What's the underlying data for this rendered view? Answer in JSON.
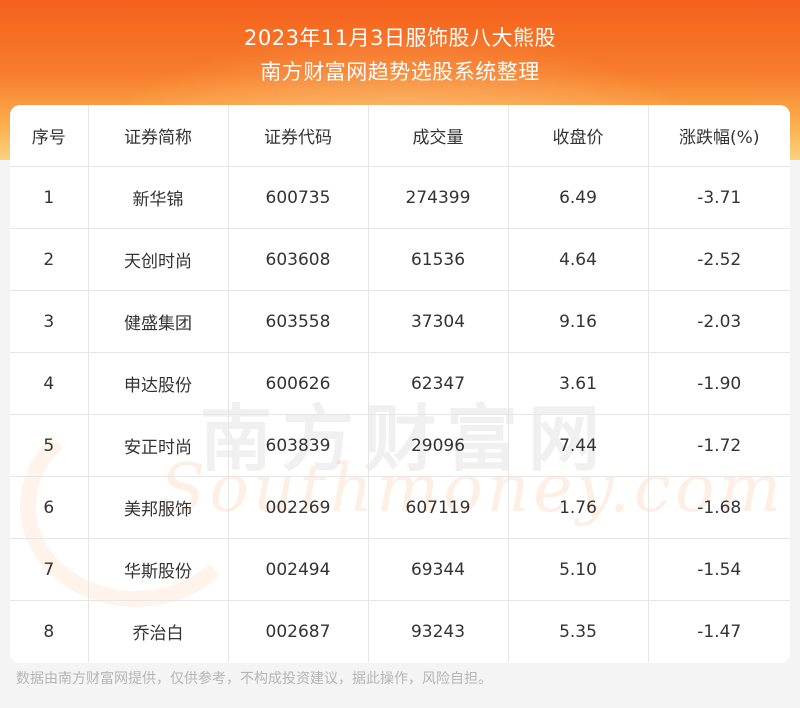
{
  "header": {
    "title_line1": "2023年11月3日服饰股八大熊股",
    "title_line2": "南方财富网趋势选股系统整理"
  },
  "table": {
    "columns": [
      "序号",
      "证券简称",
      "证券代码",
      "成交量",
      "收盘价",
      "涨跌幅(%)"
    ],
    "rows": [
      [
        "1",
        "新华锦",
        "600735",
        "274399",
        "6.49",
        "-3.71"
      ],
      [
        "2",
        "天创时尚",
        "603608",
        "61536",
        "4.64",
        "-2.52"
      ],
      [
        "3",
        "健盛集团",
        "603558",
        "37304",
        "9.16",
        "-2.03"
      ],
      [
        "4",
        "申达股份",
        "600626",
        "62347",
        "3.61",
        "-1.90"
      ],
      [
        "5",
        "安正时尚",
        "603839",
        "29096",
        "7.44",
        "-1.72"
      ],
      [
        "6",
        "美邦服饰",
        "002269",
        "607119",
        "1.76",
        "-1.68"
      ],
      [
        "7",
        "华斯股份",
        "002494",
        "69344",
        "5.10",
        "-1.54"
      ],
      [
        "8",
        "乔治白",
        "002687",
        "93243",
        "5.35",
        "-1.47"
      ]
    ]
  },
  "watermark": {
    "cn": "南方财富网",
    "en": "Southmoney.com"
  },
  "footer": {
    "disclaimer": "数据由南方财富网提供，仅供参考，不构成投资建议，据此操作，风险自担。"
  }
}
